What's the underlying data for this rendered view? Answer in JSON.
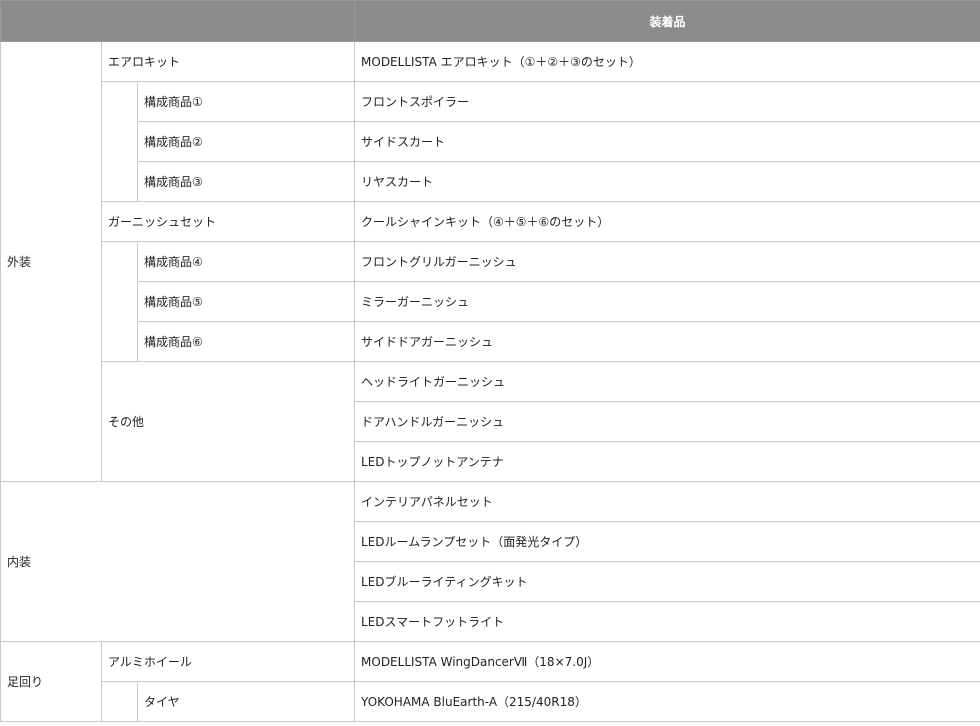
{
  "header": {
    "equipment": "装着品"
  },
  "sections": {
    "exterior": "外装",
    "interior": "内装",
    "chassis": "足回り"
  },
  "exterior": {
    "aero_kit": {
      "label": "エアロキット",
      "value": "MODELLISTA エアロキット（①＋②＋③のセット）",
      "parts": [
        {
          "label": "構成商品①",
          "value": "フロントスポイラー"
        },
        {
          "label": "構成商品②",
          "value": "サイドスカート"
        },
        {
          "label": "構成商品③",
          "value": "リヤスカート"
        }
      ]
    },
    "garnish_set": {
      "label": "ガーニッシュセット",
      "value": "クールシャインキット（④＋⑤＋⑥のセット）",
      "parts": [
        {
          "label": "構成商品④",
          "value": "フロントグリルガーニッシュ"
        },
        {
          "label": "構成商品⑤",
          "value": "ミラーガーニッシュ"
        },
        {
          "label": "構成商品⑥",
          "value": "サイドドアガーニッシュ"
        }
      ]
    },
    "other": {
      "label": "その他",
      "items": [
        "ヘッドライトガーニッシュ",
        "ドアハンドルガーニッシュ",
        "LEDトップノットアンテナ"
      ]
    }
  },
  "interior": {
    "items": [
      "インテリアパネルセット",
      "LEDルームランプセット（面発光タイプ）",
      "LEDブルーライティングキット",
      "LEDスマートフットライト"
    ]
  },
  "chassis": {
    "wheel": {
      "label": "アルミホイール",
      "value": "MODELLISTA WingDancerⅦ（18×7.0J）"
    },
    "tire": {
      "label": "タイヤ",
      "value": "YOKOHAMA BluEarth-A（215/40R18）"
    }
  }
}
